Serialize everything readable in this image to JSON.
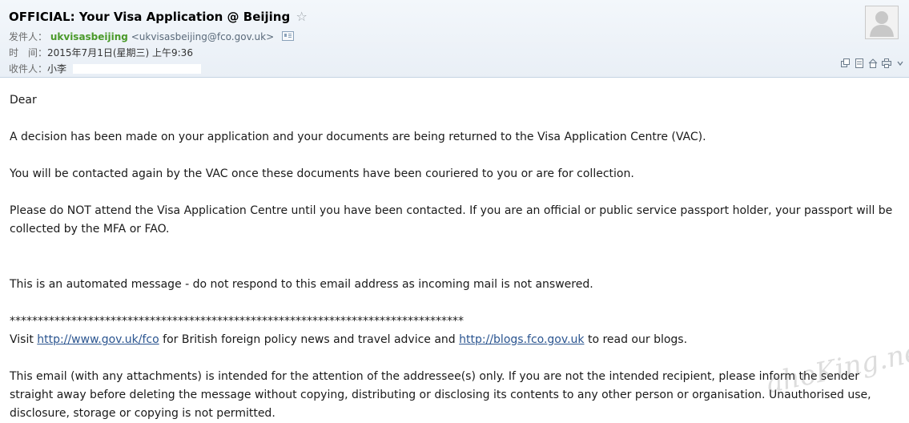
{
  "email": {
    "subject": "OFFICIAL: Your Visa Application @ Beijing",
    "star_glyph": "☆",
    "from_label": "发件人：",
    "from_name": "ukvisasbeijing",
    "from_address": "<ukvisasbeijing@fco.gov.uk>",
    "time_label": "时　间：",
    "time_value": "2015年7月1日(星期三) 上午9:36",
    "to_label": "收件人：",
    "to_value": "小李"
  },
  "toolbar": {
    "icons": [
      "popout-icon",
      "note-icon",
      "home-icon",
      "print-icon",
      "more-chevron-icon"
    ]
  },
  "body": {
    "greeting": "Dear",
    "p1": "A decision has been made on your application and your documents are being returned to the Visa Application Centre (VAC).",
    "p2": "You will be contacted again by the VAC once these documents have been couriered to you or are for collection.",
    "p3": "Please do NOT attend the Visa Application Centre until you have been contacted.  If you are an official or public service passport holder, your passport will be collected by the MFA or FAO.",
    "p4": "This is an automated message - do not respond to this email address as incoming mail is not answered.",
    "separator": "*********************************************************************************",
    "visit_prefix": "Visit ",
    "link1": "http://www.gov.uk/fco",
    "visit_mid": "  for British foreign policy news and travel advice and ",
    "link2": "http://blogs.fco.gov.uk",
    "visit_suffix": " to read our blogs.",
    "p6": "This email (with any attachments) is intended for the attention of the addressee(s) only. If you are not the intended recipient, please inform the sender straight away before deleting the message without copying, distributing or disclosing its contents to any other person or organisation. Unauthorised use, disclosure, storage or copying is not permitted."
  },
  "watermark": "ahoKing.net",
  "colors": {
    "sender_green": "#4a9a2a",
    "link_blue": "#2b5590",
    "header_bg": "#eef3f8"
  }
}
